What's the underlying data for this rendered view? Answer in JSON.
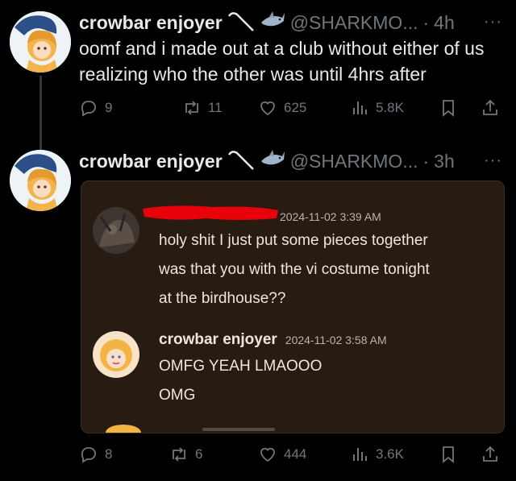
{
  "tweet1": {
    "name": "crowbar enjoyer",
    "handle": "@SHARKMO...",
    "dot": "·",
    "time": "4h",
    "more": "···",
    "text": "oomf and i made out at a club without either of us realizing who the other was until 4hrs after",
    "actions": {
      "replies": "9",
      "reposts": "11",
      "likes": "625",
      "views": "5.8K"
    }
  },
  "tweet2": {
    "name": "crowbar enjoyer",
    "handle": "@SHARKMO...",
    "dot": "·",
    "time": "3h",
    "more": "···",
    "actions": {
      "replies": "8",
      "reposts": "6",
      "likes": "444",
      "views": "3.6K"
    }
  },
  "screenshot": {
    "msg1": {
      "timestamp": "2024-11-02 3:39 AM",
      "lines": [
        "holy shit I just put some pieces together",
        "was that you with the vi costume tonight",
        "at the birdhouse??"
      ]
    },
    "msg2": {
      "author": "crowbar enjoyer",
      "timestamp": "2024-11-02 3:58 AM",
      "lines": [
        "OMFG YEAH LMAOOO",
        "OMG"
      ]
    }
  },
  "colors": {
    "bg": "#000000",
    "text": "#e7e9ea",
    "muted": "#71767b",
    "card": "#281b12",
    "redaction": "#e8000b"
  }
}
